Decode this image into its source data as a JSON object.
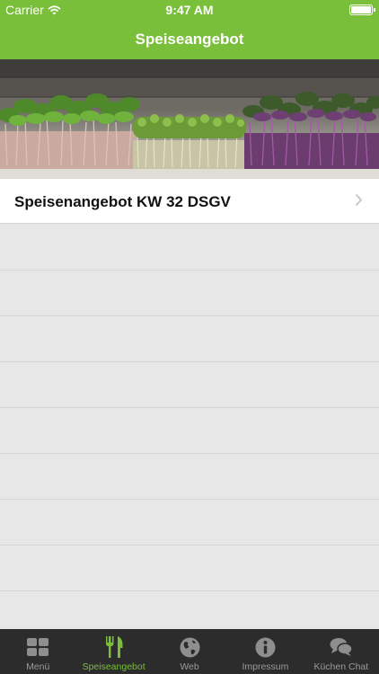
{
  "status_bar": {
    "carrier": "Carrier",
    "time": "9:47 AM"
  },
  "nav": {
    "title": "Speiseangebot"
  },
  "hero": {
    "image": "microgreens-photo"
  },
  "list": {
    "items": [
      {
        "label": "Speisenangebot KW 32 DSGV"
      }
    ]
  },
  "tabs": [
    {
      "label": "Menü",
      "icon": "grid-icon"
    },
    {
      "label": "Speiseangebot",
      "icon": "cutlery-icon",
      "active": true
    },
    {
      "label": "Web",
      "icon": "globe-icon"
    },
    {
      "label": "Impressum",
      "icon": "info-icon"
    },
    {
      "label": "Küchen Chat",
      "icon": "chat-icon"
    }
  ],
  "colors": {
    "accent": "#79bf3a",
    "tabbar": "#2c2c2c",
    "background": "#e8e7e7"
  }
}
